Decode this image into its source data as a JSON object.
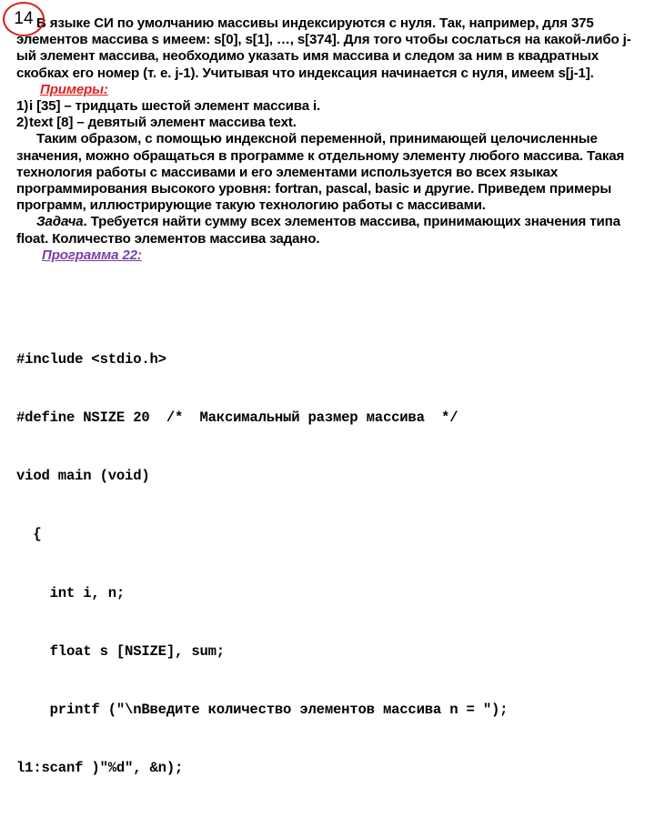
{
  "slide": {
    "page_number": "14",
    "background_color": "#ffffff",
    "accent_red": "#e02222",
    "accent_purple": "#7a3fa8",
    "badge_border_color": "#d52020"
  },
  "body": {
    "intro_paragraph": "В языке СИ по умолчанию массивы индексируются с нуля. Так, например, для 375 элементов массива s имеем: s[0], s[1], …, s[374]. Для того чтобы сослаться на какой-либо j-ый элемент массива, необходимо указать имя массива и следом за ним в квадратных скобках его номер (т. е. j-1). Учитывая что индексация начинается с нуля, имеем s[j-1].",
    "examples_heading": "Примеры:",
    "examples": [
      {
        "marker": "1)",
        "text": "i [35] – тридцать шестой элемент массива i."
      },
      {
        "marker": "2)",
        "text": "text [8] – девятый элемент массива text."
      }
    ],
    "summary_paragraph": "Таким образом, с помощью индексной переменной, принимающей целочисленные значения, можно обращаться в программе к отдельному элементу любого массива. Такая технология работы с массивами и его элементами используется во всех языках программирования высокого уровня: fortran, pascal, basic и другие. Приведем примеры программ, иллюстрирующие такую технологию работы с массивами.",
    "task_label": "Задача",
    "task_paragraph": ". Требуется найти сумму всех элементов массива, принимающих значения типа float. Количество элементов массива задано.",
    "program_heading": "Программа 22:"
  },
  "code": {
    "lines": [
      "#include <stdio.h>",
      "#define NSIZE 20  /*  Максимальный размер массива  */",
      "viod main (void)",
      "  {",
      "    int i, n;",
      "    float s [NSIZE], sum;",
      "    printf (\"\\nВведите количество элементов массива n = \");",
      "l1:scanf )\"%d\", &n);"
    ]
  }
}
